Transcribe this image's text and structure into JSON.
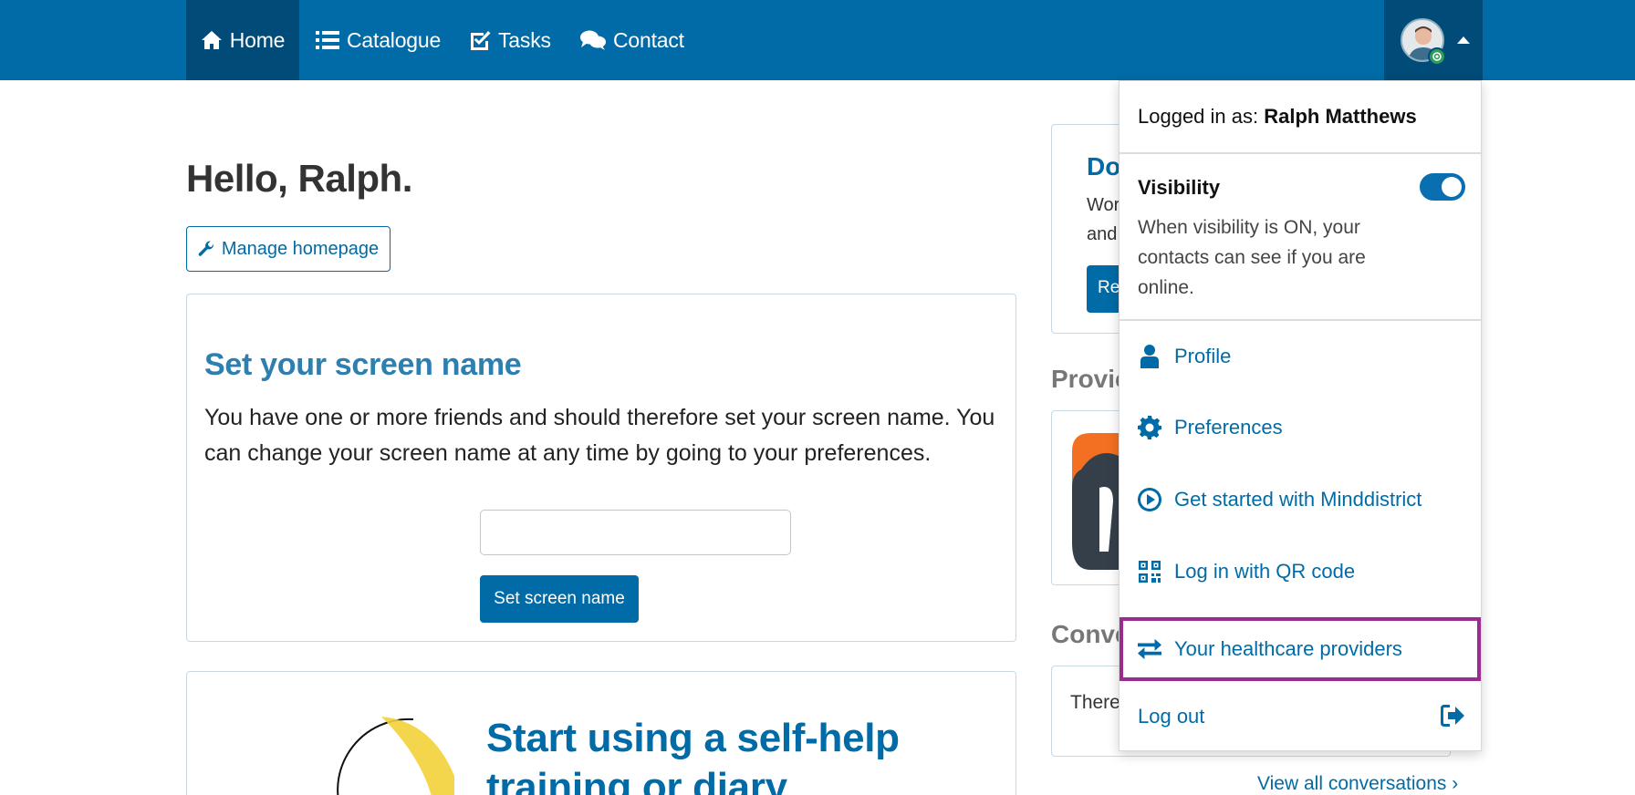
{
  "nav": {
    "home": "Home",
    "catalogue": "Catalogue",
    "tasks": "Tasks",
    "contact": "Contact"
  },
  "main": {
    "greeting": "Hello, Ralph.",
    "manage_homepage": "Manage homepage",
    "screen_name": {
      "title": "Set your screen name",
      "text": "You have one or more friends and should therefore set your screen name. You can change your screen name at any time by going to your preferences.",
      "input_value": "",
      "button": "Set screen name"
    },
    "selfhelp": {
      "title": "Start using a self-help training or diary"
    }
  },
  "side": {
    "do_title": "Do",
    "do_text_line1": "Wor",
    "do_text_line2": "and",
    "do_button": "Re",
    "providers_heading": "Provic",
    "conversations_heading": "Conve",
    "conversations_text": "There",
    "view_all": "View all conversations"
  },
  "dropdown": {
    "logged_in_label": "Logged in as:",
    "user_name": "Ralph Matthews",
    "visibility_title": "Visibility",
    "visibility_desc": "When visibility is ON, your contacts can see if you are online.",
    "visibility_on": true,
    "items": {
      "profile": "Profile",
      "preferences": "Preferences",
      "get_started": "Get started with Minddistrict",
      "qr_login": "Log in with QR code",
      "healthcare": "Your healthcare providers",
      "logout": "Log out"
    }
  },
  "colors": {
    "brand": "#006ba6",
    "brand_dark": "#004b78",
    "highlight": "#9b2c8f",
    "status_online": "#2e9d5b"
  }
}
